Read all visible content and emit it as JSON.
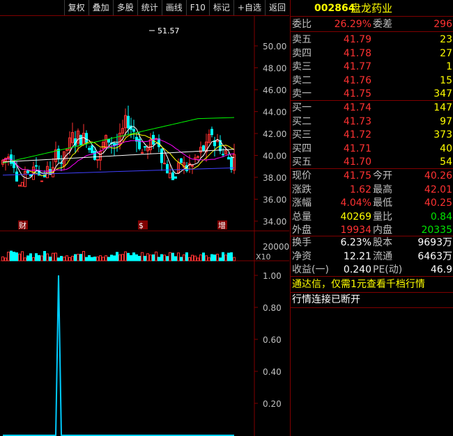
{
  "toolbar": {
    "buttons": [
      "复权",
      "叠加",
      "多股",
      "统计",
      "画线",
      "F10",
      "标记",
      "+自选",
      "返回"
    ]
  },
  "main_chart": {
    "high_label": "51.57",
    "y_axis_ticks": [
      "50.00",
      "48.00",
      "46.00",
      "44.00",
      "42.00",
      "40.00",
      "38.00",
      "36.00",
      "34.00"
    ],
    "markers": [
      "财",
      "$",
      "增"
    ],
    "colors": {
      "up": "#ff3232",
      "down": "#00ffff",
      "ma5": "#ffffff",
      "ma10": "#ffff00",
      "ma20": "#ff00ff",
      "ma60": "#00ff00",
      "ma120": "#ffffff",
      "ma250": "#4040ff"
    }
  },
  "volume_chart": {
    "tick": "20000",
    "unit_label": "X10"
  },
  "indicator_chart": {
    "y_axis_ticks": [
      "1.00",
      "0.80",
      "0.60",
      "0.40",
      "0.20"
    ]
  },
  "chart_data": {
    "type": "line",
    "series": [
      {
        "values": [
          0,
          0,
          0,
          0,
          0,
          0,
          0,
          0,
          0,
          0,
          0,
          0,
          0,
          0,
          0,
          0,
          0,
          0,
          0,
          0,
          1,
          0,
          0,
          0,
          0,
          0,
          0,
          0,
          0,
          0,
          0,
          0,
          0,
          0,
          0,
          0,
          0,
          0,
          0,
          0,
          0,
          0,
          0,
          0,
          0,
          0,
          0,
          0,
          0,
          0,
          0,
          0,
          0,
          0,
          0,
          0,
          0,
          0,
          0,
          0,
          0,
          0,
          0,
          0,
          0,
          0,
          0,
          0,
          0,
          0,
          0,
          0,
          0,
          0,
          0,
          0,
          0,
          0,
          0,
          0,
          0,
          0,
          0,
          0
        ]
      }
    ],
    "ylim": [
      0,
      1.05
    ]
  },
  "stock": {
    "code": "002864",
    "name": "盘龙药业"
  },
  "order_book": {
    "weibi_label": "委比",
    "weibi_value": "26.29%",
    "weicha_label": "委差",
    "weicha_value": "296",
    "sells": [
      {
        "label": "卖五",
        "price": "41.79",
        "volume": "23"
      },
      {
        "label": "卖四",
        "price": "41.78",
        "volume": "27"
      },
      {
        "label": "卖三",
        "price": "41.77",
        "volume": "1"
      },
      {
        "label": "卖二",
        "price": "41.76",
        "volume": "15"
      },
      {
        "label": "卖一",
        "price": "41.75",
        "volume": "347"
      }
    ],
    "buys": [
      {
        "label": "买一",
        "price": "41.74",
        "volume": "147"
      },
      {
        "label": "买二",
        "price": "41.73",
        "volume": "97"
      },
      {
        "label": "买三",
        "price": "41.72",
        "volume": "373"
      },
      {
        "label": "买四",
        "price": "41.71",
        "volume": "40"
      },
      {
        "label": "买五",
        "price": "41.70",
        "volume": "54"
      }
    ]
  },
  "quote": [
    {
      "l1": "现价",
      "v1": "41.75",
      "l2": "今开",
      "v2": "40.26"
    },
    {
      "l1": "涨跌",
      "v1": "1.62",
      "l2": "最高",
      "v2": "42.01"
    },
    {
      "l1": "涨幅",
      "v1": "4.04%",
      "l2": "最低",
      "v2": "40.25"
    },
    {
      "l1": "总量",
      "v1": "40269",
      "l2": "量比",
      "v2": "0.84"
    },
    {
      "l1": "外盘",
      "v1": "19934",
      "l2": "内盘",
      "v2": "20335"
    }
  ],
  "fundamentals": [
    {
      "l1": "换手",
      "v1": "6.23%",
      "l2": "股本",
      "v2": "9693万"
    },
    {
      "l1": "净资",
      "v1": "12.21",
      "l2": "流通",
      "v2": "6463万"
    },
    {
      "l1": "收益(一)",
      "v1": "0.240",
      "l2": "PE(动)",
      "v2": "46.9"
    }
  ],
  "notices": {
    "promo": "通达信，仅需1元查看千档行情",
    "status": "行情连接已断开"
  }
}
